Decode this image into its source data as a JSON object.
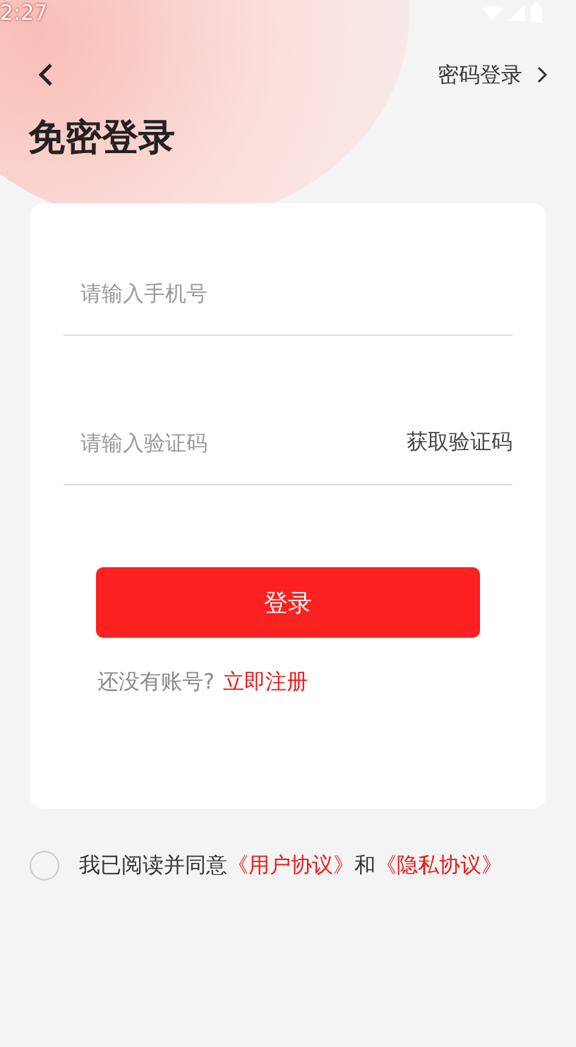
{
  "status_bar": {
    "time": "2:27"
  },
  "header": {
    "switch_link": "密码登录"
  },
  "title": "免密登录",
  "form": {
    "phone": {
      "placeholder": "请输入手机号"
    },
    "code": {
      "placeholder": "请输入验证码"
    },
    "get_code": "获取验证码",
    "submit": "登录",
    "register_prompt": "还没有账号?",
    "register_link": "立即注册"
  },
  "agreement": {
    "checked": false,
    "prefix": "我已阅读并同意",
    "user_agreement": "《用户协议》",
    "joiner": "和",
    "privacy_policy": "《隐私协议》"
  }
}
